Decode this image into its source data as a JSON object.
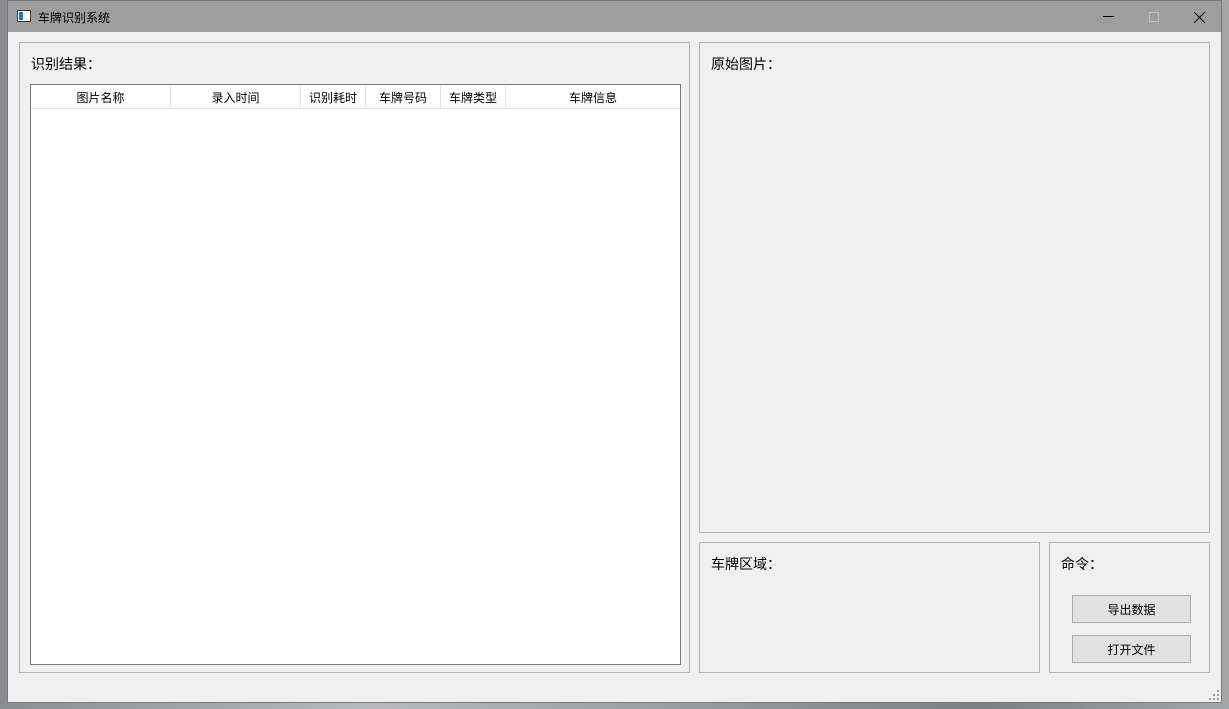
{
  "window": {
    "title": "车牌识别系统"
  },
  "results_panel": {
    "title": "识别结果：",
    "columns": [
      "图片名称",
      "录入时间",
      "识别耗时",
      "车牌号码",
      "车牌类型",
      "车牌信息"
    ]
  },
  "original_panel": {
    "title": "原始图片："
  },
  "plate_panel": {
    "title": "车牌区域："
  },
  "command_panel": {
    "title": "命令：",
    "export_label": "导出数据",
    "open_label": "打开文件"
  }
}
